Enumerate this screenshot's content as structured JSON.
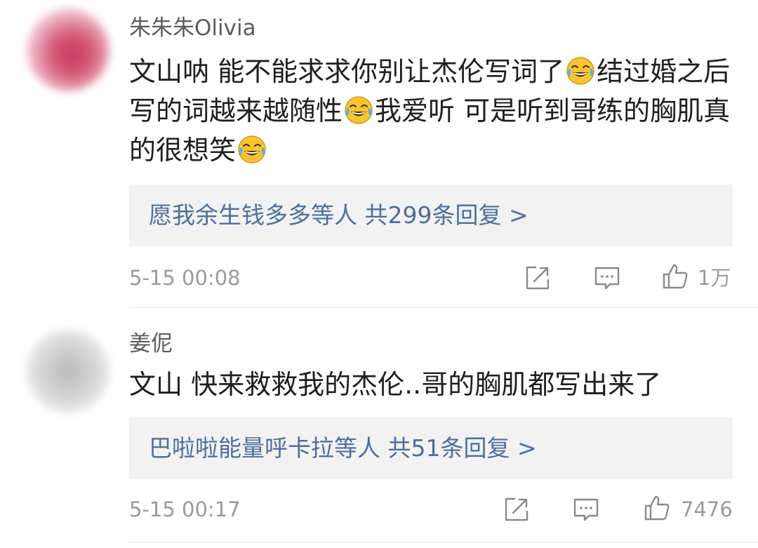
{
  "comments": [
    {
      "username": "朱朱朱Olivia",
      "text_parts": [
        "文山呐 能不能求求你别让杰伦写词了",
        "结过婚之后写的词越来越随性",
        "我爱听 可是听到哥练的胸肌真的很想笑"
      ],
      "emoji_icon": "laugh-cry-icon",
      "replies_summary": "愿我余生钱多多等人 共299条回复 >",
      "timestamp": "5-15 00:08",
      "likes": "1万"
    },
    {
      "username": "姜伲",
      "text": "文山   快来救救我的杰伦..哥的胸肌都写出来了",
      "replies_summary": "巴啦啦能量呼卡拉等人 共51条回复 >",
      "timestamp": "5-15 00:17",
      "likes": "7476"
    }
  ],
  "colors": {
    "link": "#4d6f9e",
    "meta": "#9b9b9b",
    "reply_bg": "#f2f2f2"
  }
}
